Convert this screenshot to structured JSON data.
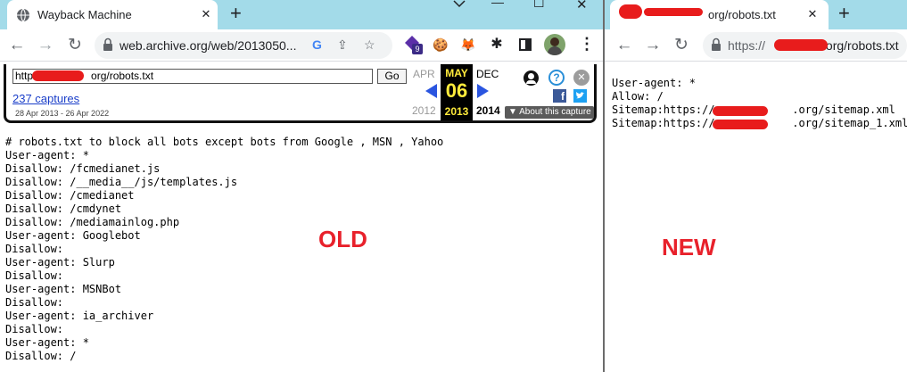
{
  "left": {
    "tab": {
      "title": "Wayback Machine",
      "close": "✕"
    },
    "new_tab": "+",
    "window_controls": {
      "minimize": "—",
      "maximize": "☐",
      "close": "✕"
    },
    "nav": {
      "back": "←",
      "forward": "→",
      "reload": "↻"
    },
    "address": "web.archive.org/web/2013050...",
    "extension_badge": "9",
    "wayback": {
      "url_value": "http://",
      "url_suffix": "org/robots.txt",
      "go": "Go",
      "captures": "237 captures",
      "range": "28 Apr 2013 - 26 Apr 2022",
      "prev_month": "APR",
      "current_month": "MAY",
      "current_day": "06",
      "current_year": "2013",
      "next_month": "DEC",
      "prev_year": "2012",
      "next_year": "2014",
      "about": "▼ About this capture",
      "help": "?",
      "facebook": "f",
      "close": "✕"
    },
    "content_lines": [
      "# robots.txt to block all bots except bots from Google , MSN , Yahoo",
      "User-agent: *",
      "Disallow: /fcmedianet.js",
      "Disallow: /__media__/js/templates.js",
      "Disallow: /cmedianet",
      "Disallow: /cmdynet",
      "Disallow: /mediamainlog.php",
      "User-agent: Googlebot",
      "Disallow:",
      "User-agent: Slurp",
      "Disallow:",
      "User-agent: MSNBot",
      "Disallow:",
      "User-agent: ia_archiver",
      "Disallow:",
      "User-agent: *",
      "Disallow: /"
    ],
    "label": "OLD"
  },
  "right": {
    "tab": {
      "title": "org/robots.txt",
      "close": "✕"
    },
    "new_tab": "+",
    "nav": {
      "back": "←",
      "forward": "→",
      "reload": "↻"
    },
    "address_prefix": "https://",
    "address_suffix": ".org/robots.txt",
    "content_lines": [
      "User-agent: *",
      "Allow: /",
      "Sitemap:https://            .org/sitemap.xml",
      "Sitemap:https://            .org/sitemap_1.xml"
    ],
    "label": "NEW"
  },
  "colors": {
    "tab_bar": "#a3dbe9",
    "redaction": "#e81c1c",
    "label": "#e8212b",
    "wayback_highlight": "#ffeb3b"
  }
}
